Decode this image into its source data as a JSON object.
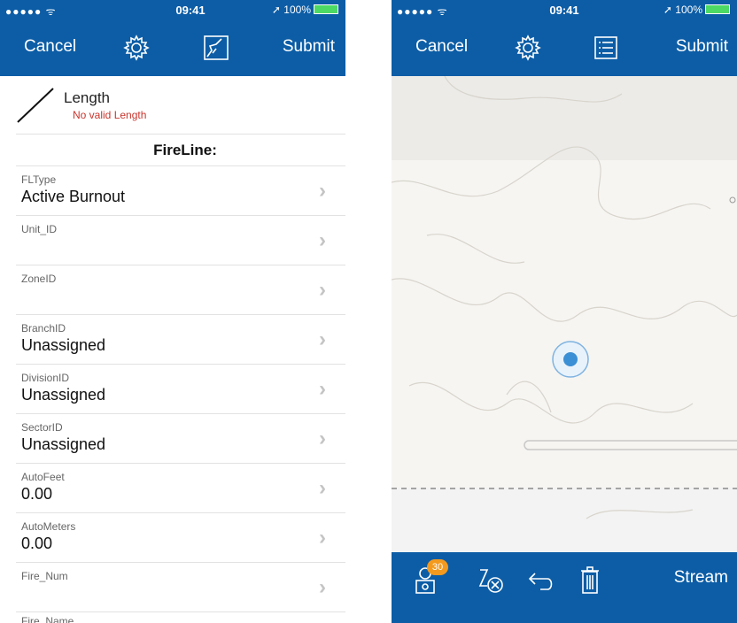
{
  "left_screen": {
    "status": {
      "signal": "●●●●● ᯤ",
      "time": "09:41",
      "battery": "➚ 100%"
    },
    "nav": {
      "cancel": "Cancel",
      "submit": "Submit",
      "icons": [
        "gear-icon",
        "sketch-map-icon"
      ]
    },
    "length": {
      "title": "Length",
      "subtitle": "No valid Length"
    },
    "section_title": "FireLine:",
    "fields": [
      {
        "label": "FLType",
        "value": "Active Burnout"
      },
      {
        "label": "Unit_ID",
        "value": ""
      },
      {
        "label": "ZoneID",
        "value": ""
      },
      {
        "label": "BranchID",
        "value": "Unassigned"
      },
      {
        "label": "DivisionID",
        "value": "Unassigned"
      },
      {
        "label": "SectorID",
        "value": "Unassigned"
      },
      {
        "label": "AutoFeet",
        "value": "0.00"
      },
      {
        "label": "AutoMeters",
        "value": "0.00"
      },
      {
        "label": "Fire_Num",
        "value": ""
      }
    ],
    "chevron": "›",
    "partial_label": "Fire_Name"
  },
  "right_screen": {
    "status": {
      "signal": "●●●●● ᯤ",
      "time": "09:41",
      "battery": "➚ 100%"
    },
    "nav": {
      "cancel": "Cancel",
      "submit": "Submit",
      "icons": [
        "gear-icon",
        "list-form-icon"
      ]
    },
    "toolbar": {
      "badge_count": "30",
      "stream_label": "Stream",
      "icons": [
        "gps-satellite-icon",
        "clear-vertices-icon",
        "undo-icon",
        "trash-icon"
      ]
    },
    "colors": {
      "nav_blue": "#0c5da6",
      "badge_orange": "#f39a1e",
      "error_red": "#c8342c"
    }
  }
}
